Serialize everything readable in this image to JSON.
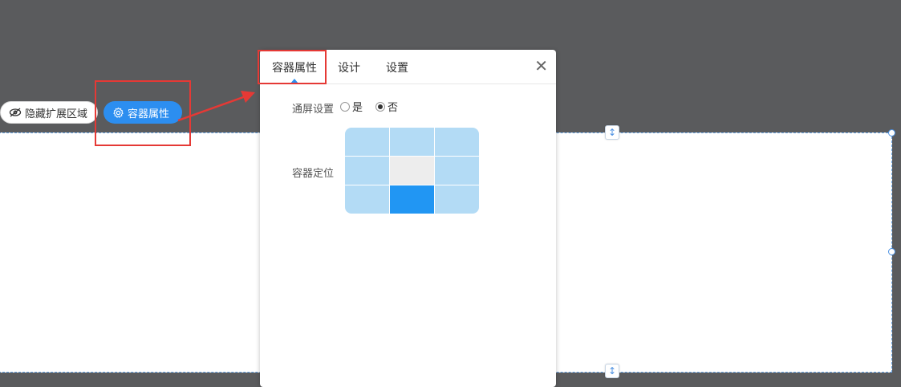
{
  "toolbar": {
    "hide_extension_label": "隐藏扩展区域",
    "hide_extension_icon": "eye-off-icon",
    "container_props_label": "容器属性",
    "container_props_icon": "gear-icon"
  },
  "panel": {
    "tabs": [
      {
        "label": "容器属性",
        "active": true
      },
      {
        "label": "设计",
        "active": false
      },
      {
        "label": "设置",
        "active": false
      }
    ],
    "close_label": "✕",
    "fullscreen": {
      "label": "通屏设置",
      "options": [
        {
          "label": "是",
          "selected": false
        },
        {
          "label": "否",
          "selected": true
        }
      ]
    },
    "position": {
      "label": "容器定位",
      "selected_cell": "bottom-center"
    }
  },
  "colors": {
    "background": "#5a5b5d",
    "accent": "#2c8ef0",
    "highlight": "#e53935",
    "grid_cell": "#b3dbf5",
    "grid_selected": "#2196f3"
  }
}
